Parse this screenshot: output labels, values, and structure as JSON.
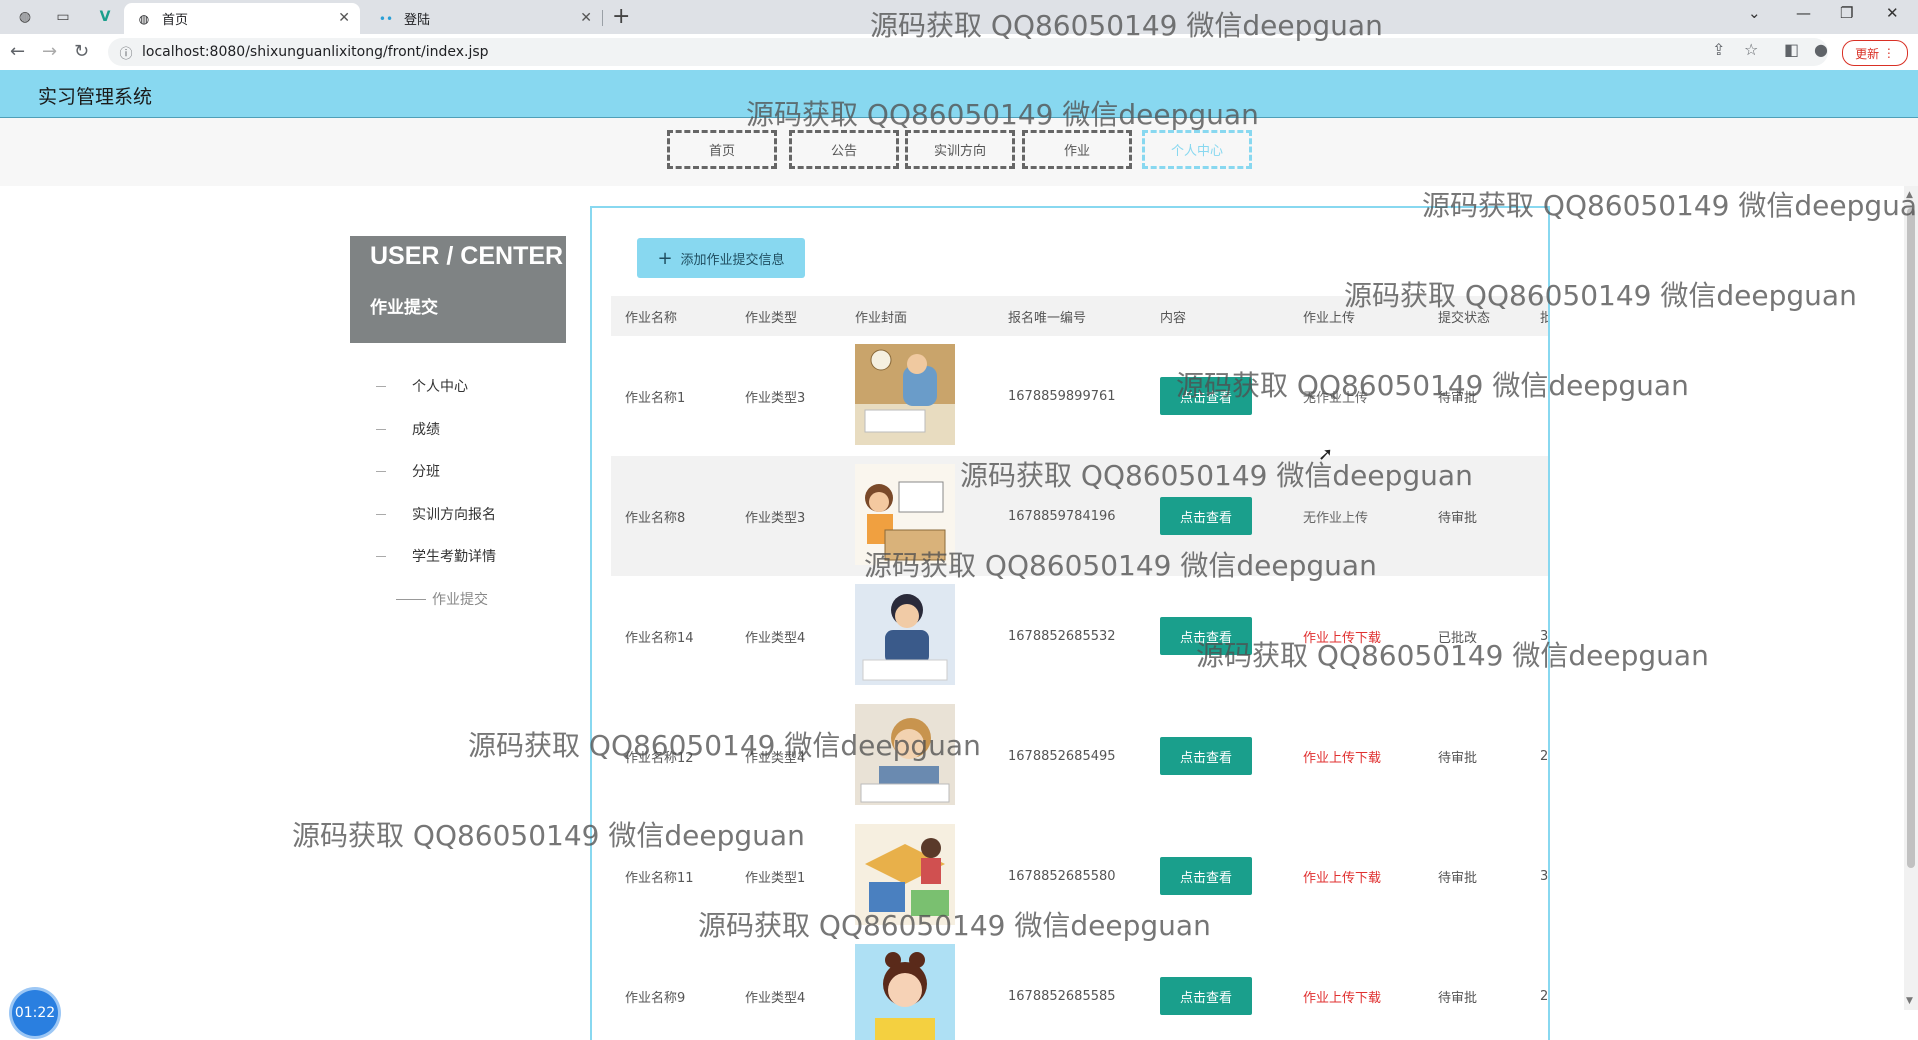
{
  "browser": {
    "tabs": [
      {
        "title": "首页",
        "active": true
      },
      {
        "title": "登陆",
        "active": false
      }
    ],
    "url": "localhost:8080/shixunguanlixitong/front/index.jsp",
    "update_label": "更新"
  },
  "app": {
    "title": "实习管理系统",
    "nav": [
      "首页",
      "公告",
      "实训方向",
      "作业",
      "个人中心"
    ],
    "active_nav": "个人中心"
  },
  "sidebar": {
    "title": "USER / CENTER",
    "subtitle": "作业提交",
    "items": [
      "个人中心",
      "成绩",
      "分班",
      "实训方向报名",
      "学生考勤详情"
    ],
    "active_sub": "作业提交"
  },
  "main": {
    "add_button": "添加作业提交信息",
    "columns": [
      "作业名称",
      "作业类型",
      "作业封面",
      "报名唯一编号",
      "内容",
      "作业上传",
      "提交状态",
      "批"
    ],
    "view_label": "点击查看",
    "rows": [
      {
        "name": "作业名称1",
        "type": "作业类型3",
        "number": "1678859899761",
        "upload": "无作业上传",
        "upload_kind": "none",
        "status": "待审批",
        "extra": ""
      },
      {
        "name": "作业名称8",
        "type": "作业类型3",
        "number": "1678859784196",
        "upload": "无作业上传",
        "upload_kind": "none",
        "status": "待审批",
        "extra": ""
      },
      {
        "name": "作业名称14",
        "type": "作业类型4",
        "number": "1678852685532",
        "upload": "作业上传下载",
        "upload_kind": "link",
        "status": "已批改",
        "extra": "3"
      },
      {
        "name": "作业名称12",
        "type": "作业类型4",
        "number": "1678852685495",
        "upload": "作业上传下载",
        "upload_kind": "link",
        "status": "待审批",
        "extra": "2"
      },
      {
        "name": "作业名称11",
        "type": "作业类型1",
        "number": "1678852685580",
        "upload": "作业上传下载",
        "upload_kind": "link",
        "status": "待审批",
        "extra": "3"
      },
      {
        "name": "作业名称9",
        "type": "作业类型4",
        "number": "1678852685585",
        "upload": "作业上传下载",
        "upload_kind": "link",
        "status": "待审批",
        "extra": "2"
      }
    ]
  },
  "timer": "01:22",
  "watermark": "源码获取 QQ86050149 微信deepguan",
  "colors": {
    "header": "#88d8f0",
    "view_button": "#1a9f8c",
    "link": "#e03030"
  }
}
